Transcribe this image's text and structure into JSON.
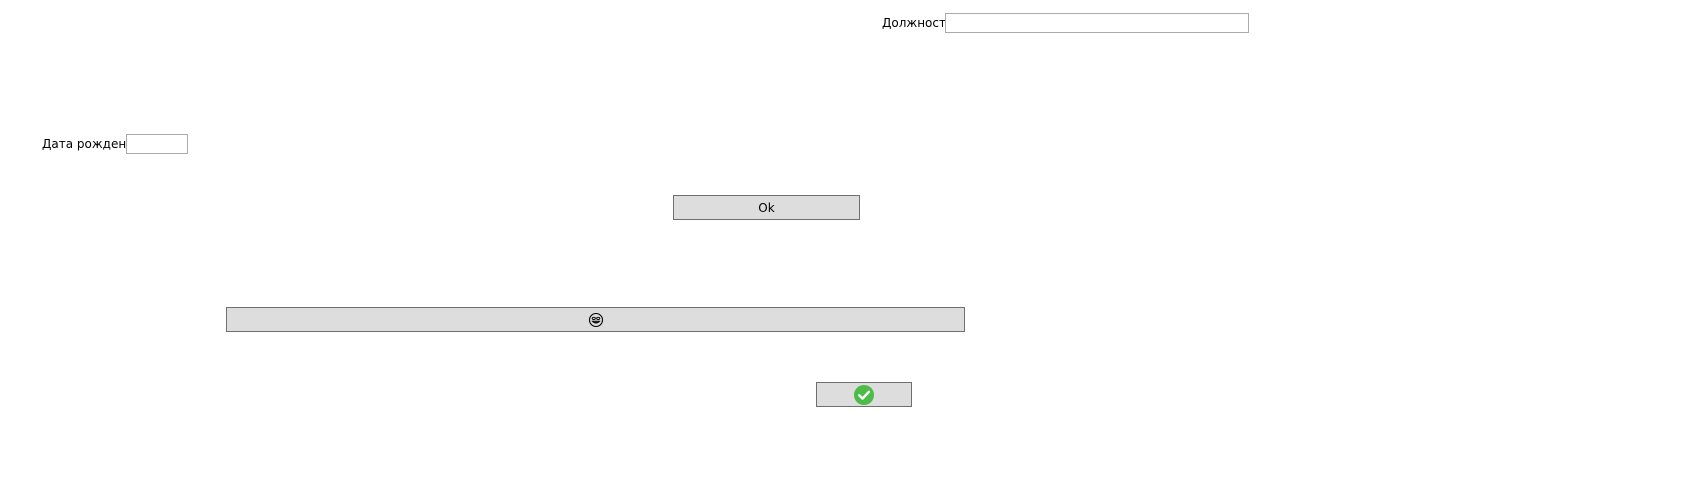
{
  "form": {
    "position_label": "Должность",
    "position_value": "",
    "birthdate_label": "Дата рождения",
    "birthdate_value": ""
  },
  "buttons": {
    "ok_label": "Ok",
    "emoji_button_icon": "smiley-icon",
    "confirm_button_icon": "check-circle-icon"
  },
  "colors": {
    "button_background": "#dddddd",
    "button_border": "#707070",
    "field_border": "#ababab",
    "check_green": "#4cbb47"
  }
}
